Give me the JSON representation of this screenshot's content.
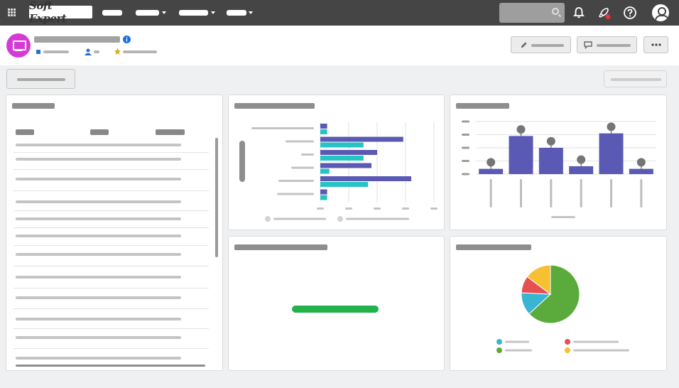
{
  "topbar": {
    "logo_text": "Soft Expert",
    "icons": [
      "apps-grid-icon",
      "search-icon",
      "bell-icon",
      "rocket-icon",
      "help-icon",
      "user-avatar-icon"
    ],
    "notification_dot_color": "#e8323c"
  },
  "header": {
    "app_icon": "monitor-icon",
    "app_icon_color": "#d63ad6",
    "info_icon_color": "#1e6fd9",
    "star_color": "#e0a800",
    "actions": [
      "edit-pencil-icon",
      "comment-icon",
      "more-icon"
    ]
  },
  "colors": {
    "bar_purple": "#5a5ab4",
    "bar_teal": "#26c4c4",
    "progress_green": "#22b24c",
    "pie_green": "#5aab3c",
    "pie_teal": "#39b4d2",
    "pie_red": "#e65050",
    "pie_yellow": "#f5c132"
  },
  "chart_data": [
    {
      "type": "bar",
      "orientation": "horizontal",
      "categories_count": 6,
      "series": [
        {
          "values": [
            6,
            73,
            50,
            45,
            80,
            6
          ]
        },
        {
          "values": [
            6,
            38,
            38,
            8,
            42,
            6
          ]
        }
      ],
      "xlim": [
        0,
        100
      ],
      "legend_position": "bottom",
      "grid": true
    },
    {
      "type": "bar",
      "categories_count": 6,
      "values": [
        8,
        58,
        40,
        12,
        62,
        8
      ],
      "error_high": [
        18,
        68,
        50,
        22,
        72,
        18
      ],
      "ylim": [
        0,
        80
      ],
      "grid": true
    },
    {
      "type": "pie",
      "slices": [
        {
          "value": 60
        },
        {
          "value": 12
        },
        {
          "value": 9
        },
        {
          "value": 14
        }
      ],
      "legend_position": "bottom"
    },
    {
      "type": "progress",
      "value_fraction": 1.0
    }
  ]
}
